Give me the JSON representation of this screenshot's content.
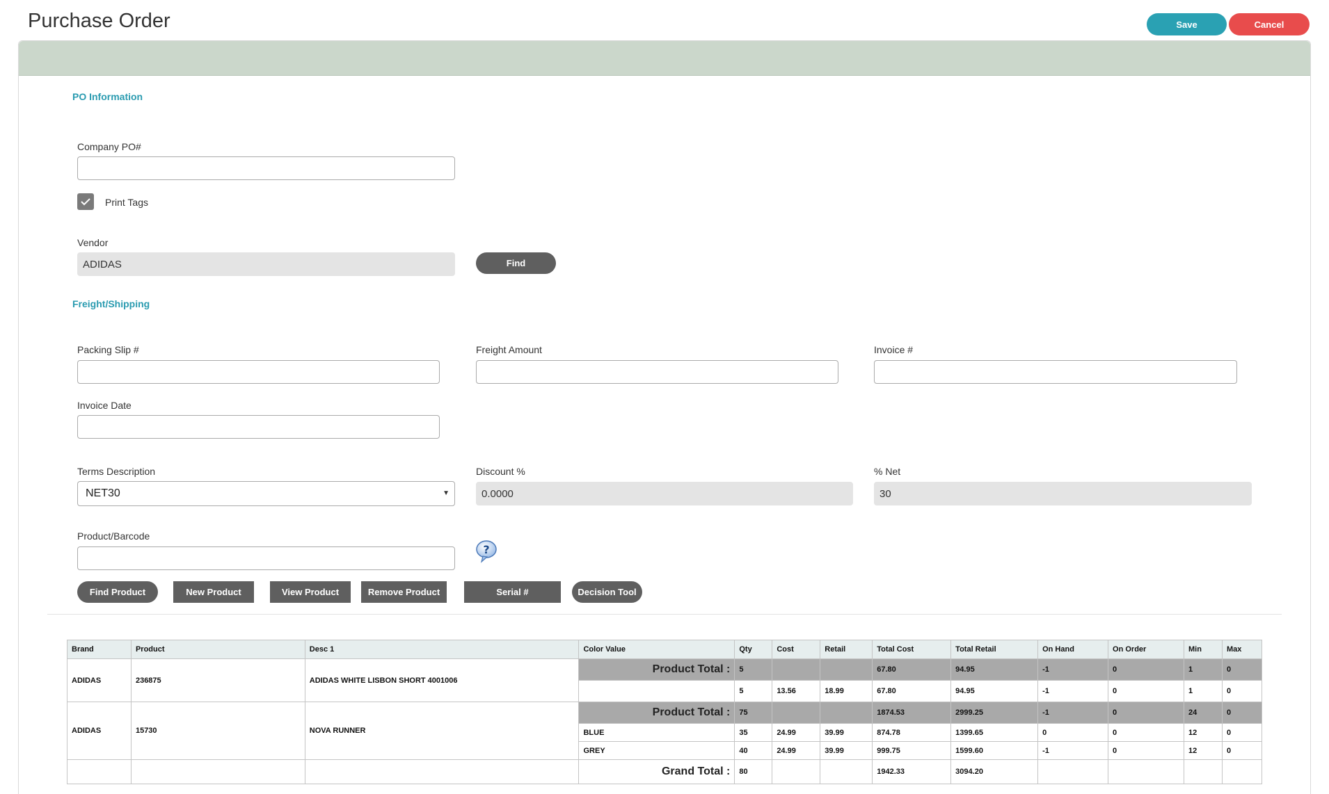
{
  "header": {
    "title": "Purchase Order",
    "save_label": "Save",
    "cancel_label": "Cancel"
  },
  "po_info": {
    "section_title": "PO Information",
    "company_po_label": "Company PO#",
    "company_po_value": "",
    "print_tags_label": "Print Tags",
    "print_tags_checked": true,
    "vendor_label": "Vendor",
    "vendor_value": "ADIDAS",
    "find_label": "Find"
  },
  "freight": {
    "section_title": "Freight/Shipping",
    "packing_slip_label": "Packing Slip #",
    "packing_slip_value": "",
    "freight_amount_label": "Freight Amount",
    "freight_amount_value": "",
    "invoice_label": "Invoice #",
    "invoice_value": "",
    "invoice_date_label": "Invoice Date",
    "invoice_date_value": "",
    "terms_label": "Terms Description",
    "terms_value": "NET30",
    "discount_label": "Discount %",
    "discount_value": "0.0000",
    "net_label": "% Net",
    "net_value": "30",
    "product_barcode_label": "Product/Barcode",
    "product_barcode_value": ""
  },
  "actions": {
    "find_product": "Find Product",
    "new_product": "New Product",
    "view_product": "View Product",
    "remove_product": "Remove Product",
    "serial": "Serial #",
    "decision_tool": "Decision Tool"
  },
  "table": {
    "headers": [
      "Brand",
      "Product",
      "Desc 1",
      "Color Value",
      "Qty",
      "Cost",
      "Retail",
      "Total Cost",
      "Total Retail",
      "On Hand",
      "On Order",
      "Min",
      "Max"
    ],
    "product_total_label": "Product Total :",
    "grand_total_label": "Grand Total :",
    "products": [
      {
        "brand": "ADIDAS",
        "product": "236875",
        "desc": "ADIDAS WHITE LISBON SHORT 4001006",
        "total": {
          "qty": "5",
          "cost": "",
          "retail": "",
          "total_cost": "67.80",
          "total_retail": "94.95",
          "on_hand": "-1",
          "on_order": "0",
          "min": "1",
          "max": "0"
        },
        "rows": [
          {
            "color": "",
            "qty": "5",
            "cost": "13.56",
            "retail": "18.99",
            "total_cost": "67.80",
            "total_retail": "94.95",
            "on_hand": "-1",
            "on_order": "0",
            "min": "1",
            "max": "0"
          }
        ]
      },
      {
        "brand": "ADIDAS",
        "product": "15730",
        "desc": "NOVA RUNNER",
        "total": {
          "qty": "75",
          "cost": "",
          "retail": "",
          "total_cost": "1874.53",
          "total_retail": "2999.25",
          "on_hand": "-1",
          "on_order": "0",
          "min": "24",
          "max": "0"
        },
        "rows": [
          {
            "color": "BLUE",
            "qty": "35",
            "cost": "24.99",
            "retail": "39.99",
            "total_cost": "874.78",
            "total_retail": "1399.65",
            "on_hand": "0",
            "on_order": "0",
            "min": "12",
            "max": "0"
          },
          {
            "color": "GREY",
            "qty": "40",
            "cost": "24.99",
            "retail": "39.99",
            "total_cost": "999.75",
            "total_retail": "1599.60",
            "on_hand": "-1",
            "on_order": "0",
            "min": "12",
            "max": "0"
          }
        ]
      }
    ],
    "grand_total": {
      "qty": "80",
      "total_cost": "1942.33",
      "total_retail": "3094.20"
    }
  }
}
